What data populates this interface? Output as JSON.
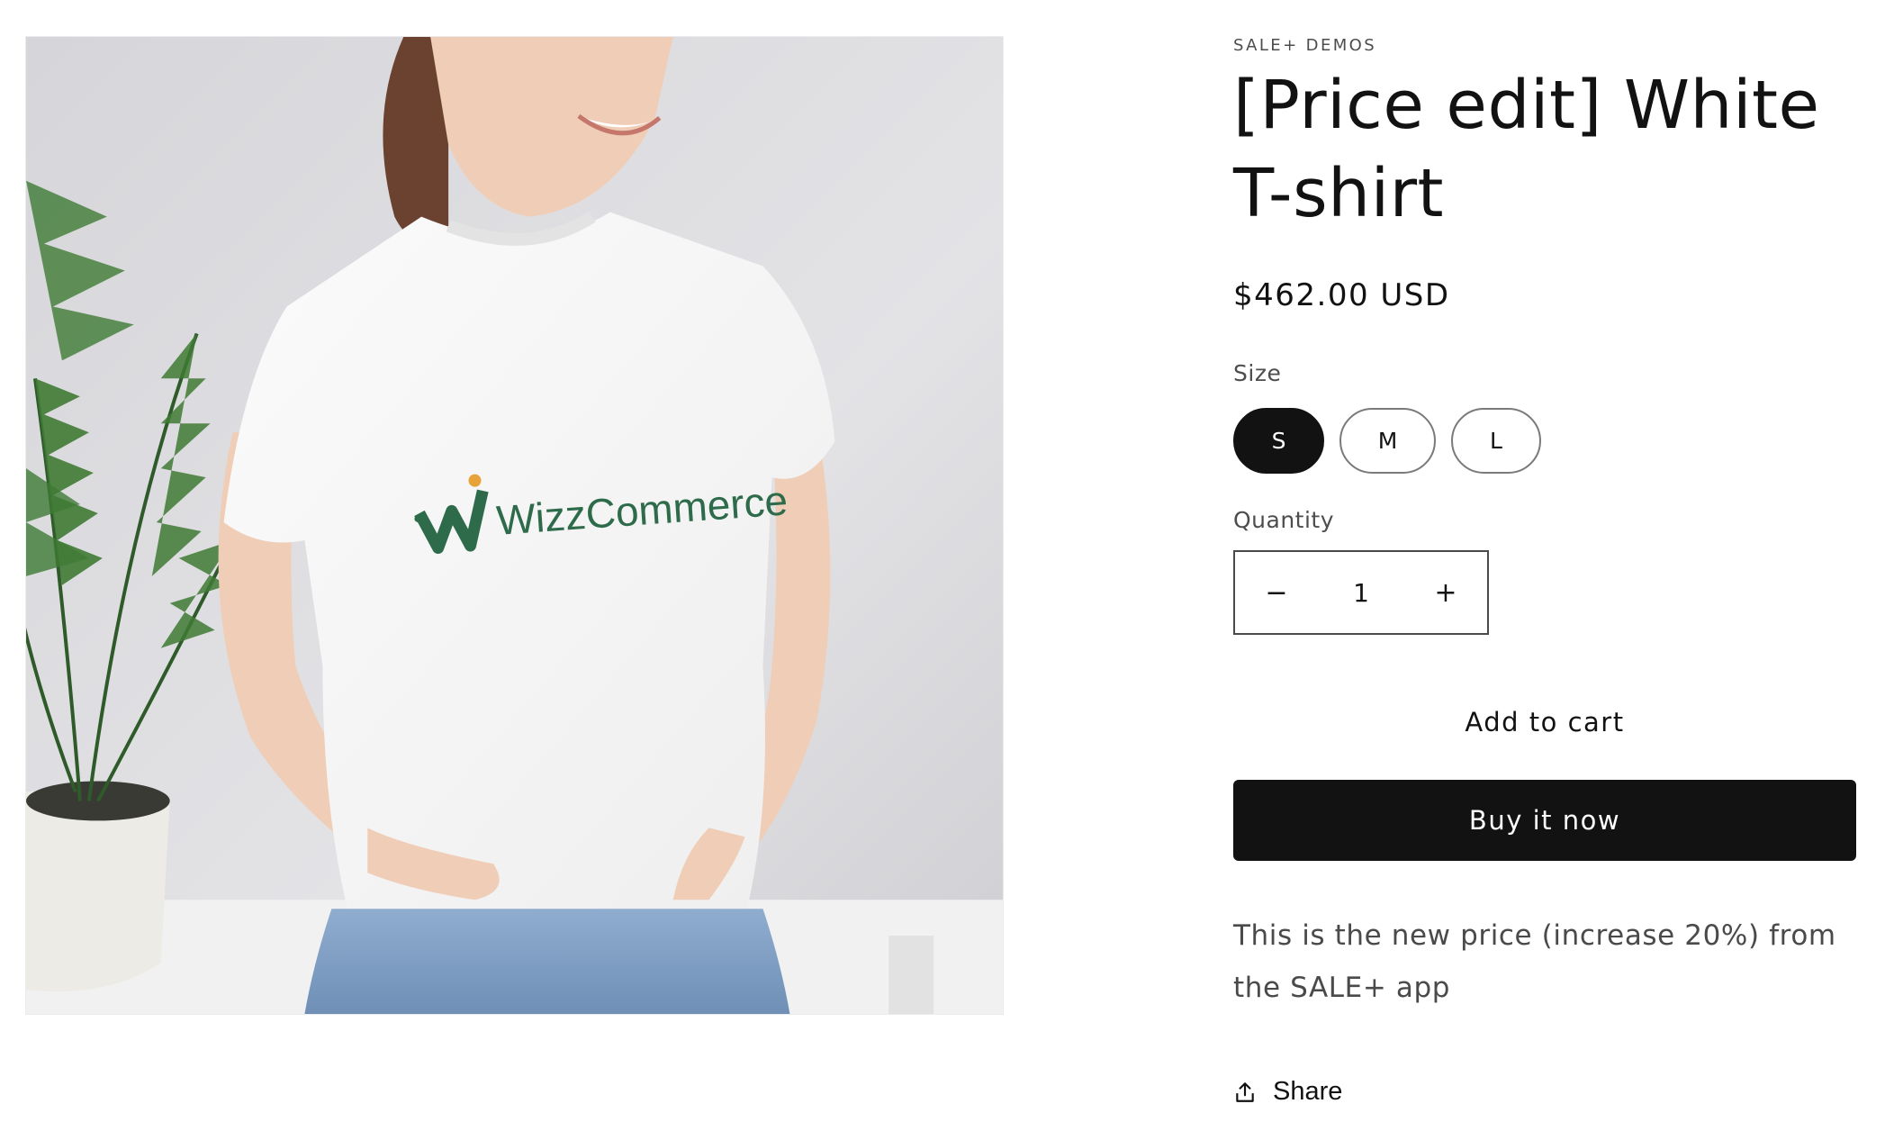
{
  "product": {
    "vendor": "SALE+ DEMOS",
    "title": "[Price edit] White T-shirt",
    "price": "$462.00 USD",
    "image_logo_text": "WizzCommerce",
    "description": "This is the new price (increase 20%) from the SALE+ app"
  },
  "size": {
    "label": "Size",
    "options": [
      "S",
      "M",
      "L"
    ],
    "selected": "S"
  },
  "quantity": {
    "label": "Quantity",
    "value": "1",
    "decrease_symbol": "−",
    "increase_symbol": "+"
  },
  "actions": {
    "add_to_cart": "Add to cart",
    "buy_now": "Buy it now",
    "share": "Share"
  },
  "colors": {
    "primary": "#121212",
    "logo_green": "#2e6b4a",
    "logo_orange": "#e8a23a"
  },
  "icons": {
    "share": "share-upload-icon"
  }
}
